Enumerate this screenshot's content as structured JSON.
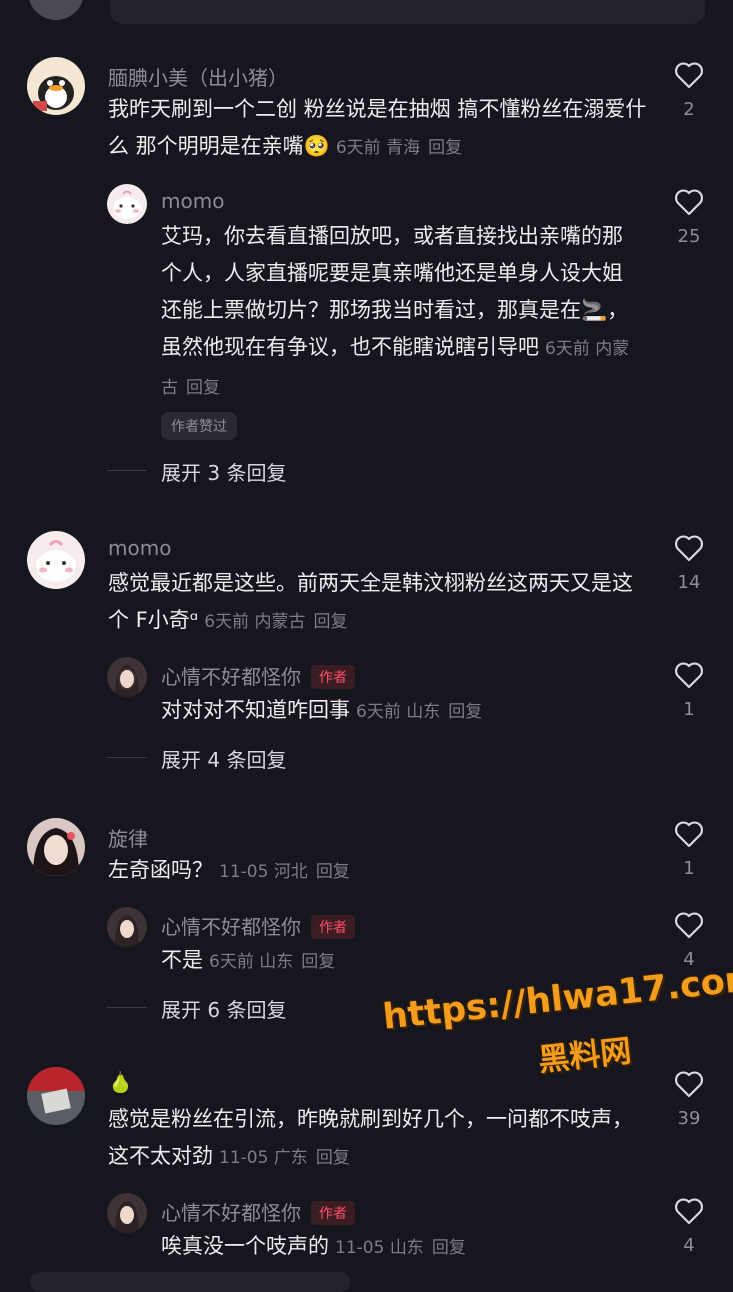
{
  "comments": [
    {
      "user": "腼腆小美（出小猪）",
      "text": "我昨天刷到一个二创 粉丝说是在抽烟 搞不懂粉丝在溺爱什么 那个明明是在亲嘴",
      "emoji": "🥺",
      "time": "6天前",
      "location": "青海",
      "reply": "回复",
      "likes": "2",
      "replies": [
        {
          "user": "momo",
          "text_a": "艾玛，你去看直播回放吧，或者直接找出亲嘴的那个人，人家直播呢要是真亲嘴他还是单身人设大姐还能上票做切片？那场我当时看过，那真是在",
          "emoji": "🚬",
          "text_b": "，虽然他现在有争议，也不能瞎说瞎引导吧",
          "time": "6天前",
          "location": "内蒙古",
          "reply": "回复",
          "likes": "25",
          "liked_tag": "作者赞过"
        }
      ],
      "expand": "展开 3 条回复"
    },
    {
      "user": "momo",
      "text": "感觉最近都是这些。前两天全是韩汶栩粉丝这两天又是这个 F小奇ᵅ",
      "time": "6天前",
      "location": "内蒙古",
      "reply": "回复",
      "likes": "14",
      "replies": [
        {
          "user": "心情不好都怪你",
          "author_tag": "作者",
          "text": "对对对不知道咋回事",
          "time": "6天前",
          "location": "山东",
          "reply": "回复",
          "likes": "1"
        }
      ],
      "expand": "展开 4 条回复"
    },
    {
      "user": "旋律",
      "text": "左奇函吗？",
      "time": "11-05",
      "location": "河北",
      "reply": "回复",
      "likes": "1",
      "replies": [
        {
          "user": "心情不好都怪你",
          "author_tag": "作者",
          "text": "不是",
          "time": "6天前",
          "location": "山东",
          "reply": "回复",
          "likes": "4"
        }
      ],
      "expand": "展开 6 条回复"
    },
    {
      "user": "🍐",
      "text": "感觉是粉丝在引流，昨晚就刷到好几个，一问都不吱声，这不太对劲",
      "time": "11-05",
      "location": "广东",
      "reply": "回复",
      "likes": "39",
      "replies": [
        {
          "user": "心情不好都怪你",
          "author_tag": "作者",
          "text": "唉真没一个吱声的",
          "time": "11-05",
          "location": "山东",
          "reply": "回复",
          "likes": "4"
        }
      ]
    }
  ],
  "watermark": {
    "url": "https://hlwa17.com",
    "name": "黑料网"
  },
  "colors": {
    "background": "#16161e",
    "author_tag": "#ff4d6a",
    "watermark": "#f39d1f"
  }
}
